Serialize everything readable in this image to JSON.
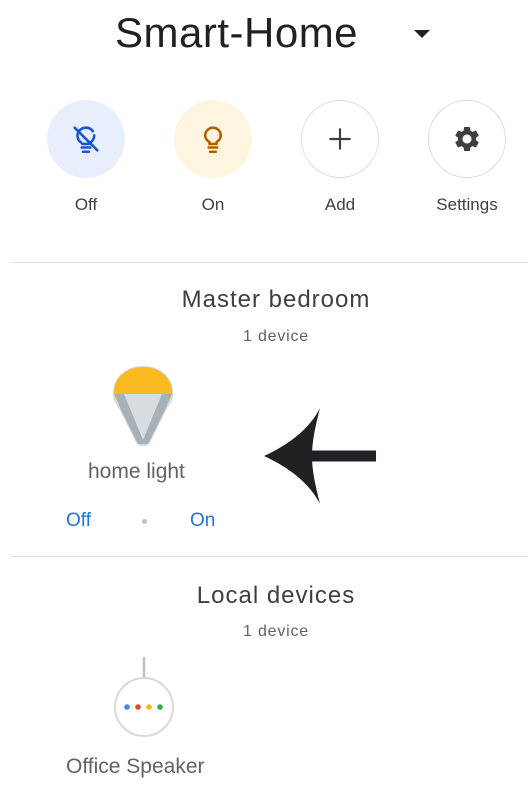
{
  "header": {
    "title": "Smart-Home"
  },
  "actions": [
    {
      "label": "Off",
      "icon": "lightbulb-off-icon"
    },
    {
      "label": "On",
      "icon": "lightbulb-icon"
    },
    {
      "label": "Add",
      "icon": "plus-icon"
    },
    {
      "label": "Settings",
      "icon": "gear-icon"
    }
  ],
  "rooms": [
    {
      "name": "Master bedroom",
      "count": "1 device",
      "devices": [
        {
          "name": "home light",
          "icon": "smart-bulb-icon",
          "controls": {
            "off_label": "Off",
            "on_label": "On"
          }
        }
      ]
    },
    {
      "name": "Local devices",
      "count": "1 device",
      "devices": [
        {
          "name": "Office Speaker",
          "icon": "smart-speaker-icon"
        }
      ]
    }
  ],
  "colors": {
    "accent": "#1a73e8",
    "off_bg": "#e8eefc",
    "on_bg": "#fef5e0",
    "bulb_glow": "#f9b921",
    "text": "#202124"
  }
}
